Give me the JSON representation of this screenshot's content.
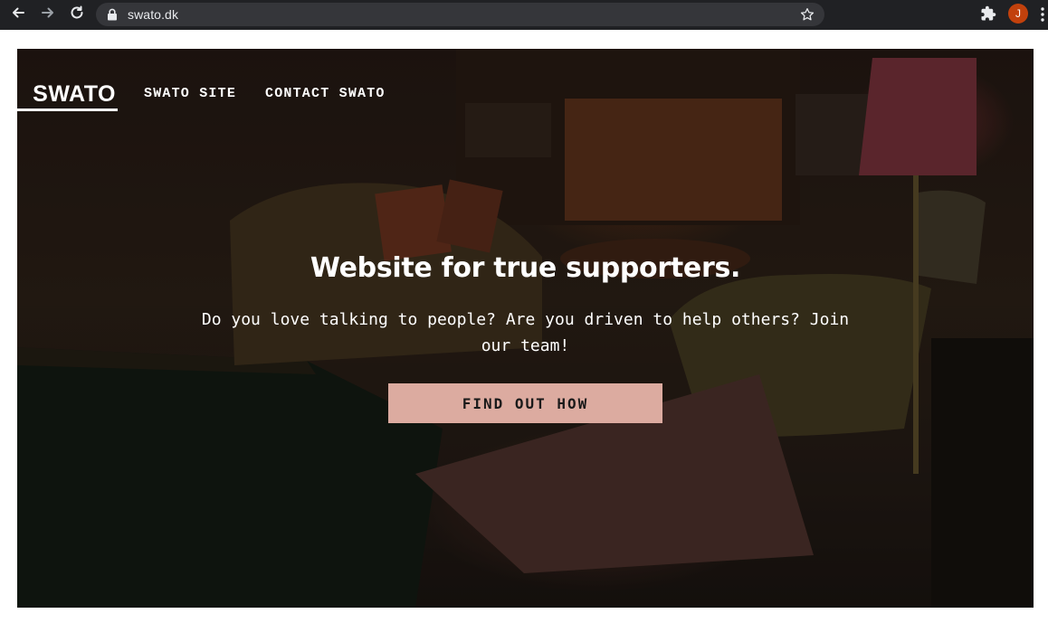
{
  "browser": {
    "url": "swato.dk",
    "avatar_initial": "J",
    "icons": {
      "back": "arrow-left-icon",
      "forward": "arrow-right-icon",
      "reload": "reload-icon",
      "lock": "lock-icon",
      "bookmark": "star-icon",
      "extensions": "puzzle-icon",
      "menu": "kebab-menu-icon"
    }
  },
  "site": {
    "logo": "SWATO",
    "nav": [
      "SWATO SITE",
      "CONTACT SWATO"
    ],
    "hero": {
      "headline": "Website for true supporters.",
      "subtext": "Do you love talking to people? Are you driven to help others? Join our team!",
      "cta_label": "FIND OUT HOW"
    }
  },
  "colors": {
    "chrome_bg": "#202124",
    "omnibox_bg": "#35363a",
    "avatar_bg": "#c2410c",
    "cta_bg": "#dcaba0",
    "text_light": "#ffffff"
  }
}
